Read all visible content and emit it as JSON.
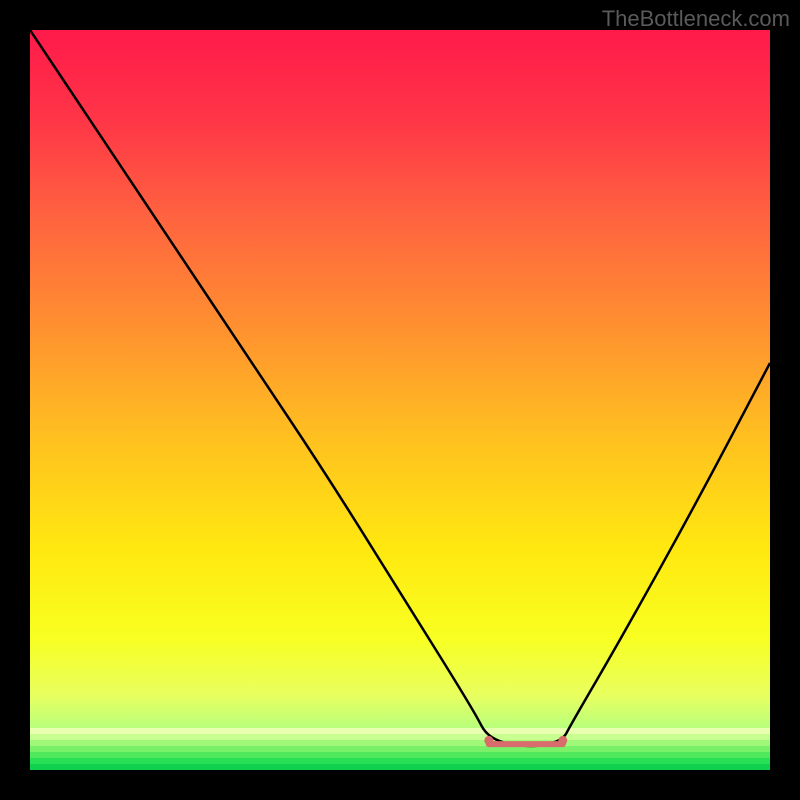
{
  "watermark": "TheBottleneck.com",
  "chart_data": {
    "type": "line",
    "title": "",
    "xlabel": "",
    "ylabel": "",
    "xlim": [
      0,
      100
    ],
    "ylim": [
      0,
      100
    ],
    "series": [
      {
        "name": "bottleneck-curve",
        "x": [
          0,
          10,
          20,
          30,
          40,
          50,
          60,
          62,
          68,
          72,
          73,
          80,
          90,
          100
        ],
        "y": [
          100,
          85,
          70,
          55,
          40,
          24,
          8,
          4,
          3,
          4,
          6,
          18,
          36,
          55
        ]
      }
    ],
    "markers": [
      {
        "name": "left-marker",
        "x": 62,
        "y": 4,
        "color": "#d86b6b",
        "size_start": 6
      },
      {
        "name": "right-marker",
        "x": 72,
        "y": 4,
        "color": "#d86b6b",
        "size_end": 6
      }
    ],
    "bottom_segment": {
      "x_start": 62,
      "x_end": 72,
      "y": 3.5,
      "color": "#d86b6b",
      "thickness": 6
    },
    "background_gradient": {
      "stops": [
        {
          "pos": 0.0,
          "color": "#ff1a4a"
        },
        {
          "pos": 0.12,
          "color": "#ff3547"
        },
        {
          "pos": 0.25,
          "color": "#ff6240"
        },
        {
          "pos": 0.4,
          "color": "#ff9030"
        },
        {
          "pos": 0.55,
          "color": "#ffc020"
        },
        {
          "pos": 0.7,
          "color": "#ffe810"
        },
        {
          "pos": 0.82,
          "color": "#f8ff20"
        },
        {
          "pos": 0.9,
          "color": "#e8ff60"
        },
        {
          "pos": 0.95,
          "color": "#b0ff80"
        },
        {
          "pos": 1.0,
          "color": "#20e060"
        }
      ]
    },
    "green_strips": {
      "count": 7,
      "base_color_start": "#e0ff90",
      "base_color_end": "#10d050"
    }
  }
}
